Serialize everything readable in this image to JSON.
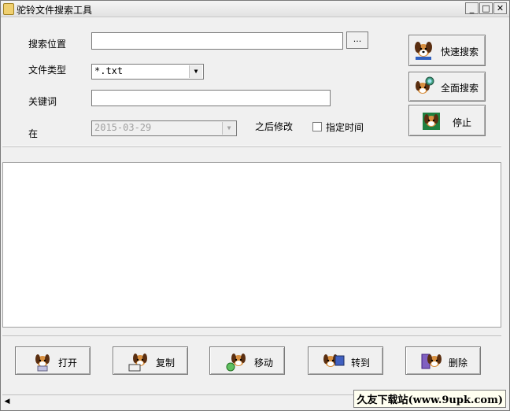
{
  "window": {
    "title": "驼铃文件搜索工具",
    "controls": {
      "minimize": "_",
      "maximize": "□",
      "close": "✕"
    }
  },
  "search": {
    "location_label": "搜索位置",
    "location_value": "",
    "browse_label": "...",
    "filetype_label": "文件类型",
    "filetype_value": "*.txt",
    "keyword_label": "关键词",
    "keyword_value": "",
    "in_label": "在",
    "date_value": "2015-03-29",
    "modified_after_label": "之后修改",
    "specify_time_label": "指定时间",
    "specify_time_checked": false
  },
  "actions": {
    "quick_search": "快速搜索",
    "full_search": "全面搜索",
    "stop": "停止"
  },
  "bottom_buttons": {
    "open": "打开",
    "copy": "复制",
    "move": "移动",
    "goto": "转到",
    "delete": "删除"
  },
  "watermark": "久友下载站(www.9upk.com)",
  "icons": [
    "dog-icon",
    "search-icon",
    "stop-icon",
    "open-icon",
    "copy-icon",
    "move-icon",
    "goto-icon",
    "delete-icon"
  ]
}
